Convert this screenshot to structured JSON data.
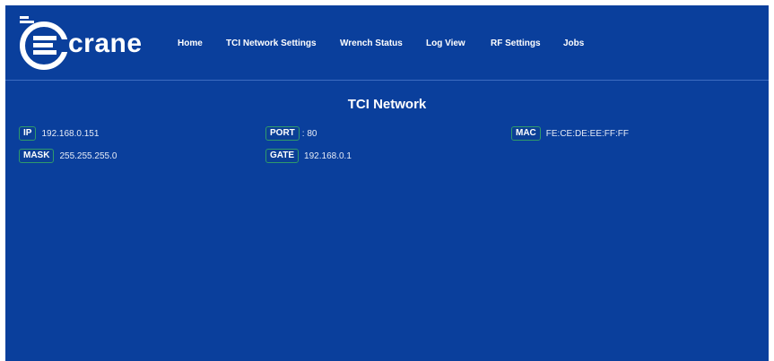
{
  "brand": {
    "name": "crane"
  },
  "nav": {
    "items": [
      {
        "label": "Home"
      },
      {
        "label": "TCI Network Settings"
      },
      {
        "label": "Wrench Status"
      },
      {
        "label": "Log View"
      },
      {
        "label": "RF Settings"
      },
      {
        "label": "Jobs"
      }
    ]
  },
  "main": {
    "title": "TCI Network",
    "fields": {
      "ip": {
        "label": "IP",
        "value": "192.168.0.151"
      },
      "port": {
        "label": "PORT",
        "value": ": 80"
      },
      "mac": {
        "label": "MAC",
        "value": "FE:CE:DE:EE:FF:FF"
      },
      "mask": {
        "label": "MASK",
        "value": "255.255.255.0"
      },
      "gate": {
        "label": "GATE",
        "value": "192.168.0.1"
      }
    }
  },
  "colors": {
    "background": "#0a3f9c",
    "badge_border": "#2f9a6b",
    "text": "#ffffff"
  }
}
